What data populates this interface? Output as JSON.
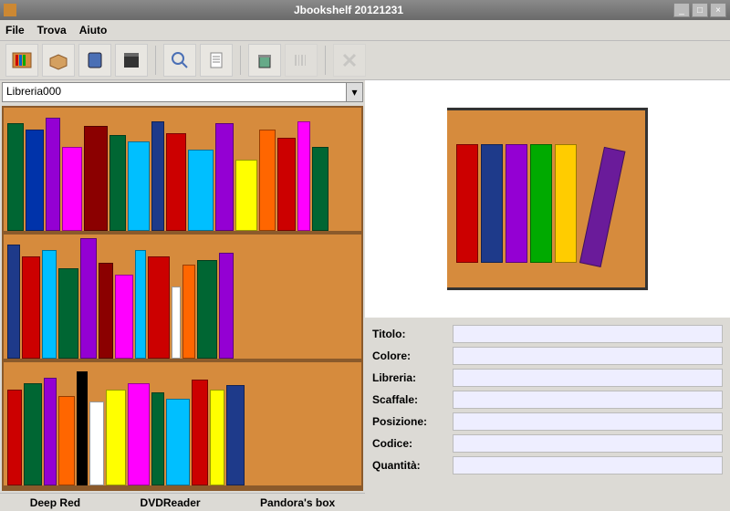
{
  "window": {
    "title": "Jbookshelf 20121231"
  },
  "menu": {
    "file": "File",
    "find": "Trova",
    "help": "Aiuto"
  },
  "library_selector": {
    "value": "Libreria000"
  },
  "form": {
    "titolo": "Titolo:",
    "colore": "Colore:",
    "libreria": "Libreria:",
    "scaffale": "Scaffale:",
    "posizione": "Posizione:",
    "codice": "Codice:",
    "quantita": "Quantità:"
  },
  "status": {
    "left": "Deep Red",
    "center": "DVDReader",
    "right": "Pandora's box"
  },
  "shelves": [
    [
      [
        "#006633",
        18,
        90
      ],
      [
        "#0033aa",
        20,
        85
      ],
      [
        "#9400d3",
        16,
        95
      ],
      [
        "#ff00ff",
        22,
        70
      ],
      [
        "#8b0000",
        26,
        88
      ],
      [
        "#006633",
        18,
        80
      ],
      [
        "#00bfff",
        24,
        75
      ],
      [
        "#1e3a8a",
        14,
        92
      ],
      [
        "#cc0000",
        22,
        82
      ],
      [
        "#00bfff",
        28,
        68
      ],
      [
        "#9400d3",
        20,
        90
      ],
      [
        "#ffff00",
        24,
        60
      ],
      [
        "#ff6600",
        18,
        85
      ],
      [
        "#cc0000",
        20,
        78
      ],
      [
        "#ff00ff",
        14,
        92
      ],
      [
        "#006633",
        18,
        70
      ]
    ],
    [
      [
        "#1e3a8a",
        14,
        95
      ],
      [
        "#cc0000",
        20,
        85
      ],
      [
        "#00bfff",
        16,
        90
      ],
      [
        "#006633",
        22,
        75
      ],
      [
        "#9400d3",
        18,
        100
      ],
      [
        "#8b0000",
        16,
        80
      ],
      [
        "#ff00ff",
        20,
        70
      ],
      [
        "#00bfff",
        12,
        90
      ],
      [
        "#cc0000",
        24,
        85
      ],
      [
        "#ffffff",
        10,
        60
      ],
      [
        "#ff6600",
        14,
        78
      ],
      [
        "#006633",
        22,
        82
      ],
      [
        "#9400d3",
        16,
        88
      ]
    ],
    [
      [
        "#cc0000",
        16,
        80
      ],
      [
        "#006633",
        20,
        85
      ],
      [
        "#9400d3",
        14,
        90
      ],
      [
        "#ff6600",
        18,
        75
      ],
      [
        "#000000",
        12,
        95
      ],
      [
        "#ffffff",
        16,
        70
      ],
      [
        "#ffff00",
        22,
        80
      ],
      [
        "#ff00ff",
        24,
        85
      ],
      [
        "#006633",
        14,
        78
      ],
      [
        "#00bfff",
        26,
        72
      ],
      [
        "#cc0000",
        18,
        88
      ],
      [
        "#ffff00",
        16,
        80
      ],
      [
        "#1e3a8a",
        20,
        84
      ]
    ]
  ],
  "preview_books": [
    [
      "#cc0000",
      1
    ],
    [
      "#1e3a8a",
      1
    ],
    [
      "#9400d3",
      1
    ],
    [
      "#00aa00",
      1
    ],
    [
      "#ffcc00",
      1
    ],
    [
      "#6a1b9a",
      1.1
    ]
  ]
}
